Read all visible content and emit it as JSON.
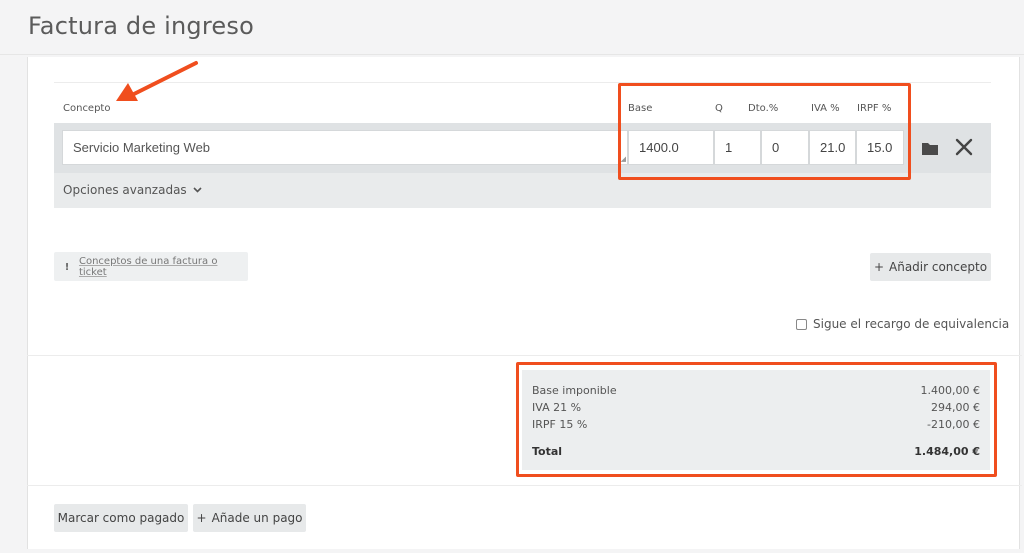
{
  "page": {
    "title": "Factura de ingreso"
  },
  "columns": {
    "concepto": "Concepto",
    "base": "Base",
    "q": "Q",
    "dto": "Dto.%",
    "iva": "IVA %",
    "irpf": "IRPF %"
  },
  "line": {
    "concepto": "Servicio Marketing Web",
    "base": "1400.0",
    "q": "1",
    "dto": "0",
    "iva": "21.0",
    "irpf": "15.0"
  },
  "icons": {
    "folder": "folder-icon",
    "close": "close-icon",
    "chevron": "chevron-down-icon",
    "warning": "exclamation-icon",
    "plus": "plus-icon"
  },
  "advanced_label": "Opciones avanzadas",
  "help_badge": "Conceptos de una factura o ticket",
  "add_concept_label": "Añadir concepto",
  "recargo_label": "Sigue el recargo de equivalencia",
  "totals": {
    "base_label": "Base imponible",
    "base_value": "1.400,00 €",
    "iva_label": "IVA 21 %",
    "iva_value": "294,00 €",
    "irpf_label": "IRPF 15 %",
    "irpf_value": "-210,00 €",
    "total_label": "Total",
    "total_value": "1.484,00 €"
  },
  "actions": {
    "mark_paid": "Marcar como pagado",
    "add_payment": "Añade un pago"
  },
  "colors": {
    "highlight": "#f04e1e",
    "band": "#e9ebec",
    "button_bg": "#e7e9ea"
  }
}
